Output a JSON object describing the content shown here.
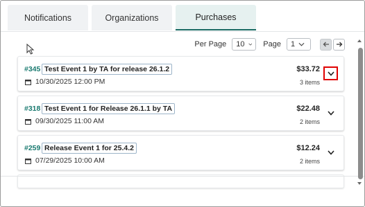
{
  "tabs": [
    {
      "label": "Notifications"
    },
    {
      "label": "Organizations"
    },
    {
      "label": "Purchases"
    }
  ],
  "pager": {
    "per_page_label": "Per Page",
    "per_page_value": "10",
    "page_label": "Page",
    "page_value": "1"
  },
  "orders": [
    {
      "number": "#345",
      "title": "Test Event 1 by TA for release 26.1.2",
      "date": "10/30/2025 12:00 PM",
      "amount": "$33.72",
      "items": "3 items"
    },
    {
      "number": "#318",
      "title": "Test Event 1 for Release 26.1.1 by TA",
      "date": "09/30/2025 11:00 AM",
      "amount": "$22.48",
      "items": "2 items"
    },
    {
      "number": "#259",
      "title": "Release Event 1 for 25.4.2",
      "date": "07/29/2025 10:00 AM",
      "amount": "$12.24",
      "items": "2 items"
    }
  ],
  "colors": {
    "accent": "#1a6b64",
    "order_number": "#1a7a70",
    "highlight": "#e00000"
  },
  "icons": [
    "calendar-icon",
    "chevron-down-icon",
    "arrow-left-icon",
    "arrow-right-icon",
    "mouse-cursor-icon"
  ]
}
